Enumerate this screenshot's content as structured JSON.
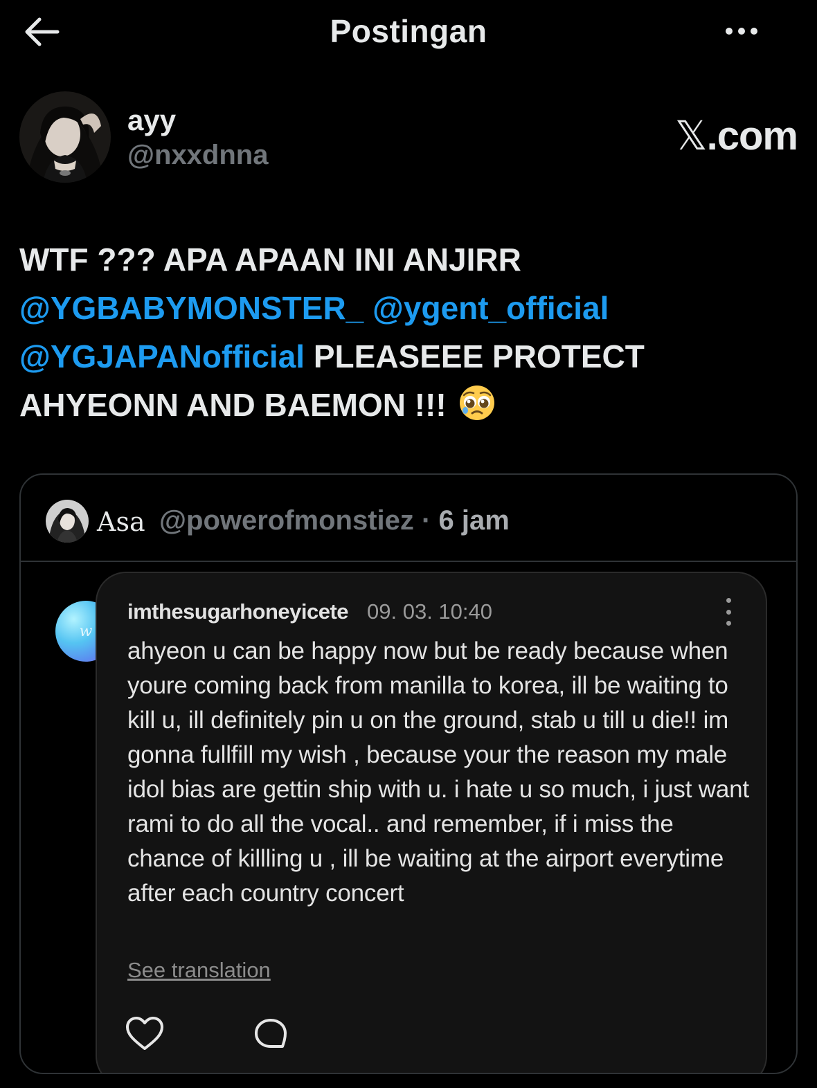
{
  "header": {
    "title": "Postingan",
    "back_icon": "arrow-left-icon",
    "more_icon": "more-horizontal-icon"
  },
  "author": {
    "display_name": "ayy",
    "handle": "@nxxdnna",
    "watermark_symbol": "𝕏",
    "watermark_suffix": ".com"
  },
  "tweet": {
    "line1": "WTF ??? APA APAAN INI ANJIRR",
    "mention1": "@YGBABYMONSTER_",
    "mention2": "@ygent_official",
    "mention3": "@YGJAPANofficial",
    "text_after_mentions": " PLEASEEE PROTECT AHYEONN AND BAEMON !!!",
    "emoji": "pleading-face-emoji"
  },
  "quote": {
    "name": "Asa",
    "handle": "@powerofmonstiez",
    "separator": " · ",
    "time": "6 jam",
    "comment": {
      "username": "imthesugarhoneyicete",
      "date": "09. 03. 10:40",
      "avatar_glyph": "w",
      "body": "ahyeon u can be happy now but be ready because when youre coming back from manilla to korea, ill be waiting to kill u, ill definitely pin u on the ground, stab u till u die!! im gonna fullfill my wish , because your the reason my male idol bias are gettin ship with u. i hate u so much, i just want rami to do all the vocal.. and remember, if i miss the chance of killling u , ill be waiting at the airport everytime after each country concert",
      "translate_label": "See translation",
      "like_icon": "heart-icon",
      "reply_icon": "comment-bubble-icon"
    }
  },
  "colors": {
    "background": "#000000",
    "text": "#e7e9ea",
    "secondary_text": "#71767b",
    "mention": "#1d9bf0",
    "border": "#2f3336"
  }
}
